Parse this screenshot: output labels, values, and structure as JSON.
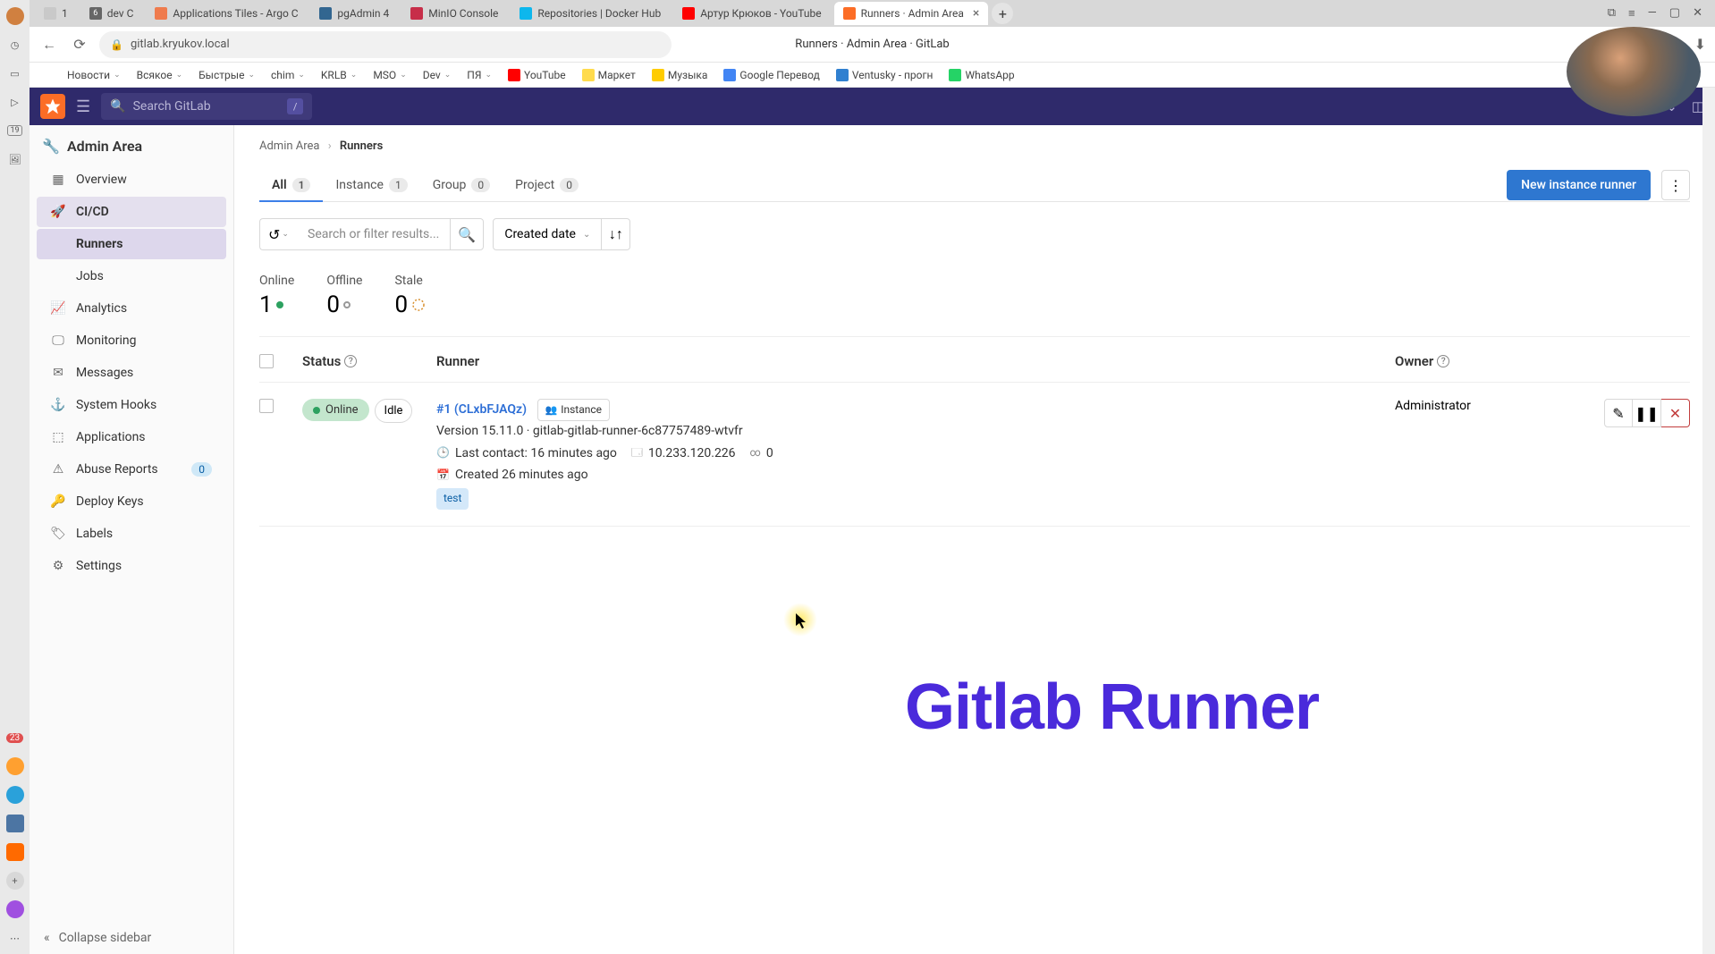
{
  "browser": {
    "tabs": [
      {
        "label": "1",
        "fav": "#c9c9c9"
      },
      {
        "label": "dev C",
        "fav": "#666",
        "badge": "6"
      },
      {
        "label": "Applications Tiles - Argo C",
        "fav": "#ef7b4d"
      },
      {
        "label": "pgAdmin 4",
        "fav": "#326690"
      },
      {
        "label": "MinIO Console",
        "fav": "#c72e49"
      },
      {
        "label": "Repositories | Docker Hub",
        "fav": "#0db7ed"
      },
      {
        "label": "Артур Крюков - YouTube",
        "fav": "#ff0000"
      },
      {
        "label": "Runners · Admin Area",
        "fav": "#fc6d26",
        "active": true
      }
    ],
    "url": "gitlab.kryukov.local",
    "page_title": "Runners · Admin Area · GitLab",
    "bookmarks": [
      {
        "label": "Новости"
      },
      {
        "label": "Всякое"
      },
      {
        "label": "Быстрые"
      },
      {
        "label": "chim"
      },
      {
        "label": "KRLB"
      },
      {
        "label": "MSO"
      },
      {
        "label": "Dev"
      },
      {
        "label": "ПЯ"
      },
      {
        "label": "YouTube",
        "ico": "#ff0000"
      },
      {
        "label": "Маркет",
        "ico": "#ffdb4d"
      },
      {
        "label": "Музыка",
        "ico": "#ffcc00"
      },
      {
        "label": "Google Перевод",
        "ico": "#4285f4"
      },
      {
        "label": "Ventusky - прогн",
        "ico": "#3080d0"
      },
      {
        "label": "WhatsApp",
        "ico": "#25d366"
      }
    ]
  },
  "os_rail": {
    "badge_23": "23",
    "badge_19": "19"
  },
  "gitlab": {
    "search_placeholder": "Search GitLab",
    "search_key": "/"
  },
  "sidebar": {
    "title": "Admin Area",
    "items": [
      {
        "label": "Overview",
        "icon": "overview-icon"
      },
      {
        "label": "CI/CD",
        "icon": "cicd-icon",
        "active": true
      },
      {
        "label": "Runners",
        "nested": true,
        "selected": true
      },
      {
        "label": "Jobs",
        "nested": true
      },
      {
        "label": "Analytics",
        "icon": "analytics-icon"
      },
      {
        "label": "Monitoring",
        "icon": "monitoring-icon"
      },
      {
        "label": "Messages",
        "icon": "messages-icon"
      },
      {
        "label": "System Hooks",
        "icon": "hooks-icon"
      },
      {
        "label": "Applications",
        "icon": "apps-icon"
      },
      {
        "label": "Abuse Reports",
        "icon": "abuse-icon",
        "pill": "0"
      },
      {
        "label": "Deploy Keys",
        "icon": "keys-icon"
      },
      {
        "label": "Labels",
        "icon": "labels-icon"
      },
      {
        "label": "Settings",
        "icon": "settings-icon"
      }
    ],
    "collapse": "Collapse sidebar"
  },
  "crumbs": {
    "root": "Admin Area",
    "current": "Runners"
  },
  "tabs": {
    "items": [
      {
        "label": "All",
        "count": "1",
        "active": true
      },
      {
        "label": "Instance",
        "count": "1"
      },
      {
        "label": "Group",
        "count": "0"
      },
      {
        "label": "Project",
        "count": "0"
      }
    ],
    "new_btn": "New instance runner"
  },
  "filter": {
    "placeholder": "Search or filter results...",
    "sort": "Created date"
  },
  "stats": {
    "online": {
      "label": "Online",
      "value": "1"
    },
    "offline": {
      "label": "Offline",
      "value": "0"
    },
    "stale": {
      "label": "Stale",
      "value": "0"
    }
  },
  "table": {
    "headers": {
      "status": "Status",
      "runner": "Runner",
      "owner": "Owner"
    },
    "row": {
      "status": "Online",
      "idle": "Idle",
      "name": "#1 (CLxbFJAQz)",
      "type": "Instance",
      "version_line": "Version 15.11.0 · gitlab-gitlab-runner-6c87757489-wtvfr",
      "last_contact": "Last contact: 16 minutes ago",
      "ip": "10.233.120.226",
      "jobs": "0",
      "created": "Created 26 minutes ago",
      "tag": "test",
      "owner": "Administrator"
    }
  },
  "overlay": "Gitlab Runner"
}
